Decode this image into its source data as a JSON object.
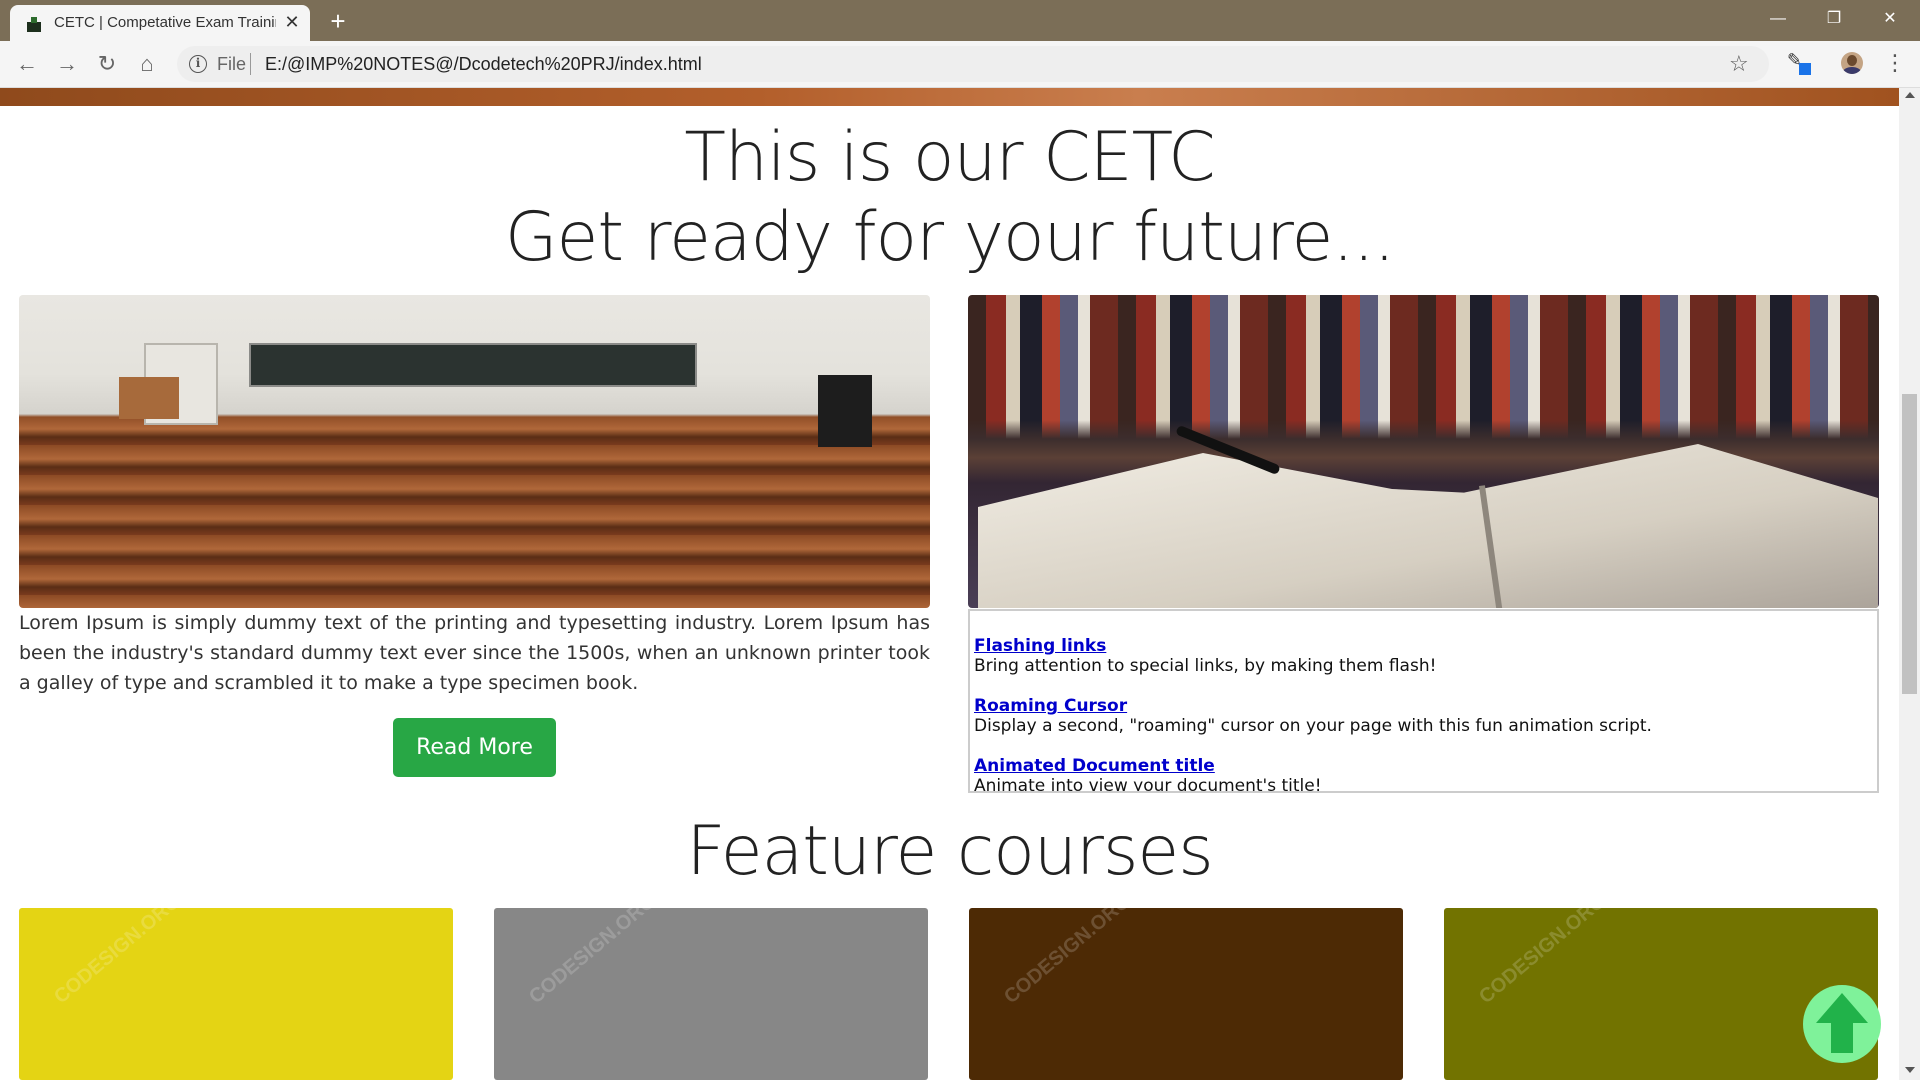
{
  "browser": {
    "tab_title": "CETC | Competative Exam Training",
    "new_tab": "+",
    "url_prefix": "File",
    "url": "E:/@IMP%20NOTES@/Dcodetech%20PRJ/index.html"
  },
  "hero": {
    "title_line1": "This is our CETC",
    "title_line2": "Get ready for your future..."
  },
  "intro": {
    "text": "Lorem Ipsum is simply dummy text of the printing and typesetting industry. Lorem Ipsum has been the industry's standard dummy text ever since the 1500s, when an unknown printer took a galley of type and scrambled it to make a type specimen book.",
    "read_more": "Read More"
  },
  "news": {
    "items": [
      {
        "link": "Flashing links",
        "desc": "Bring attention to special links, by making them flash!"
      },
      {
        "link": "Roaming Cursor",
        "desc": "Display a second, \"roaming\" cursor on your page with this fun animation script."
      },
      {
        "link": "Animated Document title",
        "desc": "Animate into view your document's title!"
      }
    ]
  },
  "courses": {
    "heading": "Feature courses",
    "cards": [
      {
        "color": "#e4d414",
        "watermark": "CODESIGN.ORG"
      },
      {
        "color": "#878787",
        "watermark": "CODESIGN.ORG"
      },
      {
        "color": "#4d2a05",
        "watermark": "CODESIGN.ORG"
      },
      {
        "color": "#727300",
        "watermark": "CODESIGN.ORG"
      }
    ]
  },
  "icons": {
    "back": "arrow-left-icon",
    "forward": "arrow-right-icon",
    "reload": "reload-icon",
    "home": "home-icon",
    "info": "info-icon",
    "star": "star-icon",
    "menu": "kebab-menu-icon",
    "scroll_top": "arrow-up-icon"
  }
}
